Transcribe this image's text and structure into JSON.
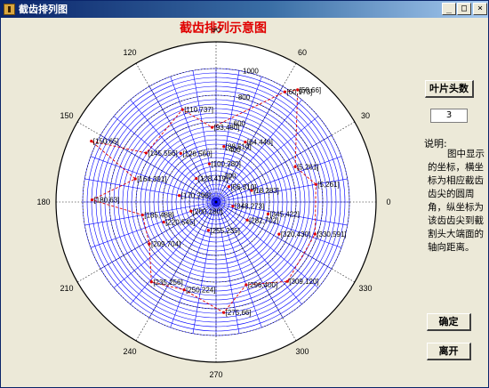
{
  "window": {
    "title": "截齿排列图"
  },
  "heading": "截齿排列示意图",
  "buttons": {
    "minimize": "_",
    "maximize": "□",
    "close": "×",
    "blade_count": "叶片头数",
    "ok": "确定",
    "leave": "离开"
  },
  "blade_count_value": "3",
  "note_title": "说明:",
  "note_text": "图中显示的坐标，横坐标为相应截齿齿尖的圆周角，纵坐标为该齿齿尖到截割头大端面的轴向距离。",
  "chart_data": {
    "type": "scatter",
    "coordinate_system": "polar",
    "r_max": 1000,
    "angle_tick_labels": [
      "0",
      "30",
      "60",
      "90",
      "120",
      "150",
      "180",
      "210",
      "240",
      "270",
      "300",
      "330"
    ],
    "radial_tick_labels": [
      "200",
      "400",
      "600",
      "800",
      "1000"
    ],
    "grid": true,
    "colors": {
      "grid": "#0000ff",
      "points": "#e00000",
      "axes": "#000000"
    },
    "points": [
      {
        "angle": 58,
        "r": 973,
        "label": "[60,973]"
      },
      {
        "angle": 54,
        "r": 1040,
        "label": "[58,66]"
      },
      {
        "angle": 110,
        "r": 737,
        "label": "[110,737]"
      },
      {
        "angle": 154,
        "r": 1040,
        "label": "[150,65]"
      },
      {
        "angle": 145,
        "r": 640,
        "label": "[145,556]"
      },
      {
        "angle": 164,
        "r": 630,
        "label": "[164,391]"
      },
      {
        "angle": 179,
        "r": 930,
        "label": "[180,63]"
      },
      {
        "angle": 100,
        "r": 290,
        "label": "[100,280]"
      },
      {
        "angle": 82,
        "r": 420,
        "label": "[88,510]"
      },
      {
        "angle": 64,
        "r": 500,
        "label": "[64,440]"
      },
      {
        "angle": 24,
        "r": 650,
        "label": "[5,261]"
      },
      {
        "angle": 10,
        "r": 760,
        "label": "[5,261]"
      },
      {
        "angle": 342,
        "r": 780,
        "label": "[330,591]"
      },
      {
        "angle": 347,
        "r": 400,
        "label": "[345,422]"
      },
      {
        "angle": 333,
        "r": 530,
        "label": "[320,430]"
      },
      {
        "angle": 312,
        "r": 800,
        "label": "[309,120]"
      },
      {
        "angle": 290,
        "r": 660,
        "label": "[296,400]"
      },
      {
        "angle": 274,
        "r": 830,
        "label": "[275,66]"
      },
      {
        "angle": 250,
        "r": 700,
        "label": "[250,224]"
      },
      {
        "angle": 231,
        "r": 770,
        "label": "[235,256]"
      },
      {
        "angle": 212,
        "r": 590,
        "label": "[209,704]"
      },
      {
        "angle": 201,
        "r": 420,
        "label": "[220,545]"
      },
      {
        "angle": 190,
        "r": 560,
        "label": "[185,488]"
      },
      {
        "angle": 170,
        "r": 280,
        "label": "[170,298]"
      },
      {
        "angle": 130,
        "r": 230,
        "label": "[128,419]"
      },
      {
        "angle": 18,
        "r": 280,
        "label": "[18,283]"
      },
      {
        "angle": 346,
        "r": 130,
        "label": "[348,273]"
      },
      {
        "angle": 330,
        "r": 270,
        "label": "[282,702]"
      },
      {
        "angle": 255,
        "r": 220,
        "label": "[255,235]"
      },
      {
        "angle": 50,
        "r": 150,
        "label": "[56,310]"
      },
      {
        "angle": 93,
        "r": 560,
        "label": "[93,480]"
      },
      {
        "angle": 126,
        "r": 450,
        "label": "[126,560]"
      },
      {
        "angle": 200,
        "r": 200,
        "label": "[200,180]"
      }
    ]
  }
}
